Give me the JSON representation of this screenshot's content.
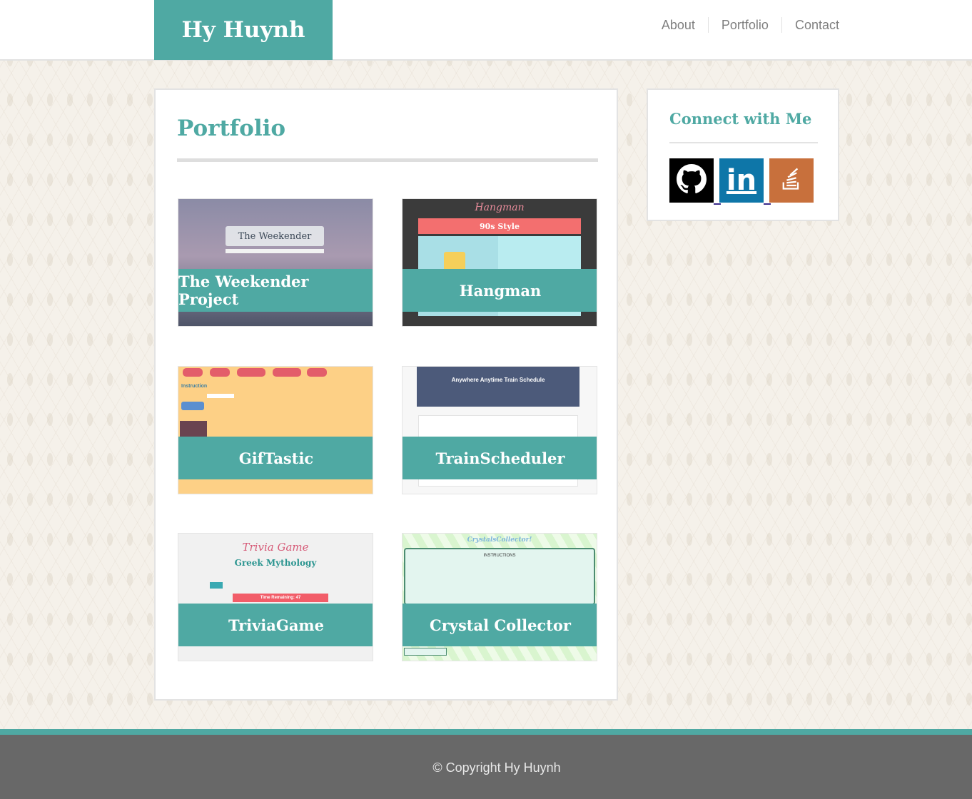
{
  "header": {
    "brand": "Hy Huynh",
    "nav": [
      "About",
      "Portfolio",
      "Contact"
    ]
  },
  "main": {
    "title": "Portfolio",
    "projects": [
      {
        "label": "The Weekender Project",
        "thumb_text": "The Weekender"
      },
      {
        "label": "Hangman",
        "thumb_title": "Hangman",
        "thumb_bar": "90s Style"
      },
      {
        "label": "GifTastic",
        "thumb_text": "Instruction"
      },
      {
        "label": "TrainScheduler",
        "thumb_text": "Anywhere Anytime Train Schedule"
      },
      {
        "label": "TriviaGame",
        "thumb_title": "Trivia Game",
        "thumb_subtitle": "Greek Mythology",
        "thumb_timer": "Time Remaining: 47"
      },
      {
        "label": "Crystal Collector",
        "thumb_title": "CrystalsCollector!",
        "thumb_text": "INSTRUCTIONS"
      }
    ]
  },
  "sidebar": {
    "title": "Connect with Me",
    "links": [
      {
        "icon": "github-icon"
      },
      {
        "icon": "linkedin-icon",
        "text": "in"
      },
      {
        "icon": "stackoverflow-icon"
      }
    ]
  },
  "footer": {
    "text": "© Copyright Hy Huynh"
  },
  "colors": {
    "accent": "#4fa9a3",
    "footer": "#686868",
    "github": "#000000",
    "linkedin": "#0e76a8",
    "stackoverflow": "#c8703c"
  }
}
